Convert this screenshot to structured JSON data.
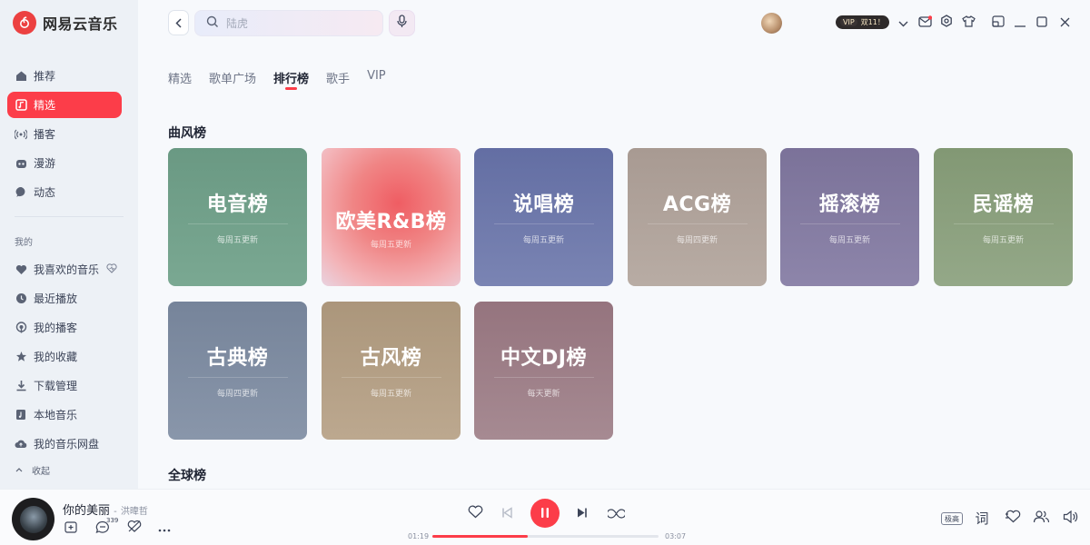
{
  "app": {
    "name": "网易云音乐"
  },
  "sidebar": {
    "items": [
      {
        "label": "推荐",
        "icon": "home-icon"
      },
      {
        "label": "精选",
        "icon": "music-note-icon",
        "active": true
      },
      {
        "label": "播客",
        "icon": "broadcast-icon"
      },
      {
        "label": "漫游",
        "icon": "roam-icon"
      },
      {
        "label": "动态",
        "icon": "chat-bubble-icon"
      }
    ],
    "section_mine": "我的",
    "mine_items": [
      {
        "label": "我喜欢的音乐",
        "icon": "heart-icon"
      },
      {
        "label": "最近播放",
        "icon": "clock-icon"
      },
      {
        "label": "我的播客",
        "icon": "podcast-icon"
      },
      {
        "label": "我的收藏",
        "icon": "star-icon"
      },
      {
        "label": "下载管理",
        "icon": "download-icon"
      },
      {
        "label": "本地音乐",
        "icon": "local-music-icon"
      },
      {
        "label": "我的音乐网盘",
        "icon": "cloud-icon"
      }
    ],
    "collapse_label": "收起"
  },
  "header": {
    "search_placeholder": "陆虎",
    "vip_label": "VIP",
    "promo_label": "双11！"
  },
  "tabs": [
    "精选",
    "歌单广场",
    "排行榜",
    "歌手",
    "VIP"
  ],
  "active_tab": "排行榜",
  "sections": {
    "style_charts": "曲风榜",
    "global_charts": "全球榜"
  },
  "cards": [
    {
      "title": "电音榜",
      "subtitle": "每周五更新",
      "color": "#6e9d86"
    },
    {
      "title": "欧美R&B榜",
      "subtitle": "每周五更新",
      "color": "#ee6e72"
    },
    {
      "title": "说唱榜",
      "subtitle": "每周五更新",
      "color": "#6873a8"
    },
    {
      "title": "ACG榜",
      "subtitle": "每周四更新",
      "color": "#ad9f97"
    },
    {
      "title": "摇滚榜",
      "subtitle": "每周五更新",
      "color": "#8079a2"
    },
    {
      "title": "民谣榜",
      "subtitle": "每周五更新",
      "color": "#879d7a"
    },
    {
      "title": "古典榜",
      "subtitle": "每周四更新",
      "color": "#7a889e"
    },
    {
      "title": "古风榜",
      "subtitle": "每周五更新",
      "color": "#b09b80"
    },
    {
      "title": "中文DJ榜",
      "subtitle": "每天更新",
      "color": "#9a7a84"
    }
  ],
  "player": {
    "song_title": "你的美丽",
    "separator": "-",
    "artist": "洪暐哲",
    "comment_count": "339",
    "current_time": "01:19",
    "total_time": "03:07",
    "progress": 0.42,
    "quality": "极高",
    "lyrics_label": "词"
  },
  "colors": {
    "accent": "#fc3d49",
    "sidebar_bg": "#edf1f6",
    "page_bg": "#f7f9fc"
  }
}
